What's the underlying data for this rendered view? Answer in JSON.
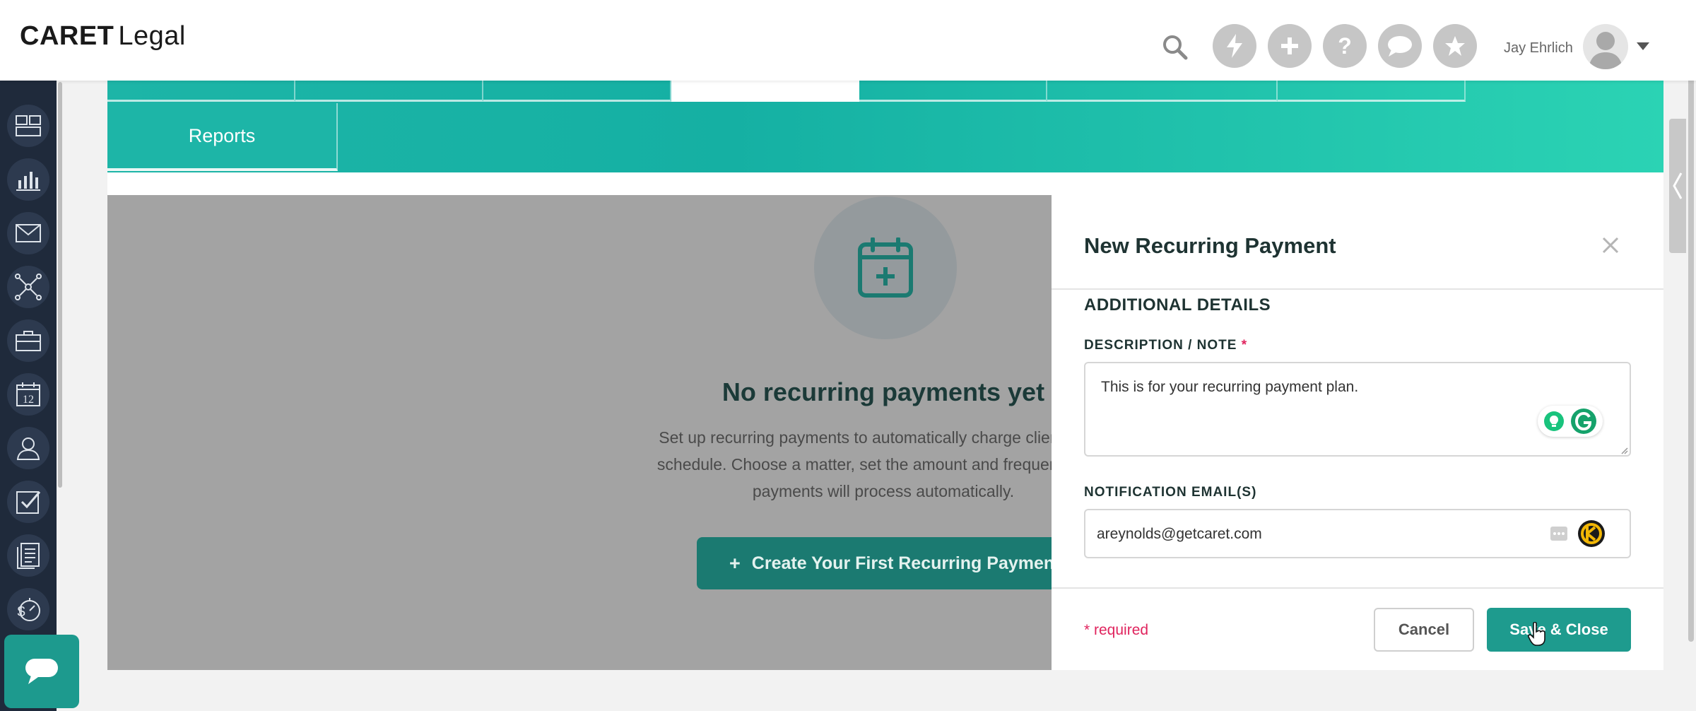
{
  "app": {
    "logo_main": "CARET",
    "logo_sub": "Legal"
  },
  "header": {
    "user_name": "Jay Ehrlich",
    "icons": [
      "search-icon",
      "lightning-icon",
      "plus-icon",
      "help-icon",
      "chat-icon",
      "star-icon"
    ]
  },
  "sidebar": {
    "icons": [
      "dashboard-icon",
      "reports-icon",
      "mail-icon",
      "network-icon",
      "briefcase-icon",
      "calendar-icon",
      "contacts-icon",
      "tasks-icon",
      "documents-icon",
      "billing-timer-icon"
    ],
    "calendar_day": "12"
  },
  "tabs": {
    "active_label": "Reports"
  },
  "empty_state": {
    "title": "No recurring payments yet",
    "description": "Set up recurring payments to automatically charge clients on a schedule. Choose a matter, set the amount and frequency, and payments will process automatically.",
    "cta_plus": "+",
    "cta_label": "Create Your First Recurring Payment"
  },
  "panel": {
    "title": "New Recurring Payment",
    "section_title": "ADDITIONAL DETAILS",
    "description_label": "DESCRIPTION / NOTE",
    "required_mark": "*",
    "description_value": "This is for your recurring payment plan.",
    "email_label": "NOTIFICATION EMAIL(S)",
    "email_value": "areynolds@getcaret.com",
    "required_note": "* required",
    "cancel_label": "Cancel",
    "save_label": "Save & Close"
  },
  "colors": {
    "brand_teal": "#1db5a7",
    "save_button": "#1e9b8e",
    "required_red": "#e0245e",
    "sidebar_dark": "#1f2a3b"
  }
}
